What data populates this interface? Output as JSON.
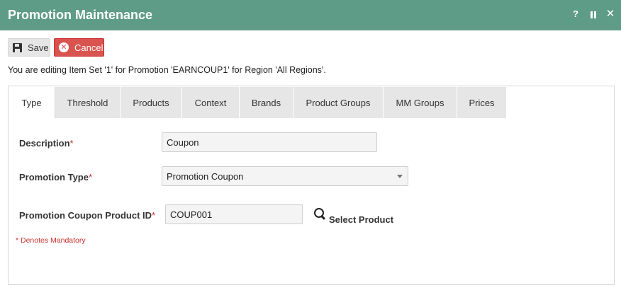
{
  "window": {
    "title": "Promotion Maintenance",
    "help_glyph": "?",
    "close_glyph": "✕"
  },
  "toolbar": {
    "save_label": "Save",
    "cancel_label": "Cancel"
  },
  "info_message": "You are editing Item Set '1' for Promotion 'EARNCOUP1' for Region 'All Regions'.",
  "tabs": [
    {
      "label": "Type",
      "active": true
    },
    {
      "label": "Threshold"
    },
    {
      "label": "Products"
    },
    {
      "label": "Context"
    },
    {
      "label": "Brands"
    },
    {
      "label": "Product Groups"
    },
    {
      "label": "MM Groups"
    },
    {
      "label": "Prices"
    }
  ],
  "form": {
    "description": {
      "label": "Description",
      "required_mark": "*",
      "value": "Coupon"
    },
    "promotion_type": {
      "label": "Promotion Type",
      "required_mark": "*",
      "value": "Promotion Coupon"
    },
    "coupon_product_id": {
      "label": "Promotion Coupon Product ID",
      "required_mark": "*",
      "value": "COUP001"
    },
    "select_product_label": "Select Product"
  },
  "mandatory_note": "* Denotes Mandatory",
  "colors": {
    "title_bar": "#5e9c88",
    "cancel_button": "#d9534f",
    "required": "#c9302c"
  }
}
